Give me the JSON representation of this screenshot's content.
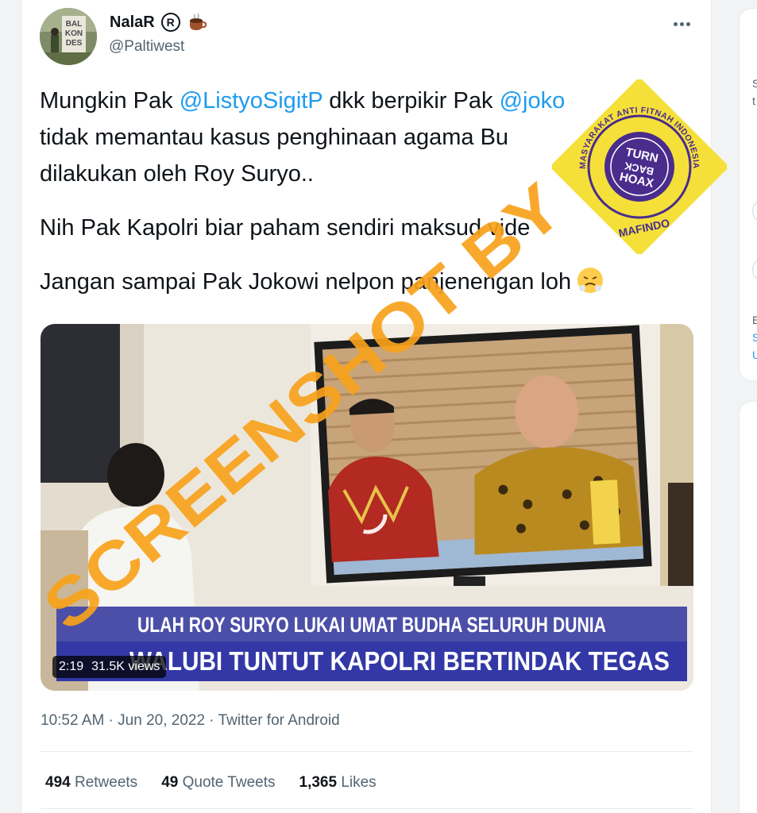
{
  "tweet": {
    "author_name": "NalaR",
    "author_handle": "@Paltiwest",
    "avatar_text": [
      "BAL",
      "KON",
      "DES"
    ],
    "text_lines": [
      [
        {
          "t": "Mungkin Pak "
        },
        {
          "t": "@ListyoSigitP",
          "m": true
        },
        {
          "t": " dkk berpikir Pak "
        },
        {
          "t": "@joko",
          "m": true
        }
      ],
      [
        {
          "t": "tidak memantau kasus penghinaan agama Bu"
        }
      ],
      [
        {
          "t": "dilakukan oleh Roy Suryo.."
        }
      ],
      [],
      [
        {
          "t": "Nih Pak Kapolri biar paham sendiri maksud vide"
        }
      ],
      [],
      [
        {
          "t": "Jangan sampai Pak Jokowi nelpon panjenengan loh "
        }
      ]
    ],
    "timestamp": "10:52 AM · Jun 20, 2022 · Twitter for Android",
    "stats": {
      "retweets_count": "494",
      "retweets_label": "Retweets",
      "quotes_count": "49",
      "quotes_label": "Quote Tweets",
      "likes_count": "1,365",
      "likes_label": "Likes"
    }
  },
  "video": {
    "duration": "2:19",
    "views": "31.5K views",
    "headline_top": "ULAH ROY SURYO LUKAI UMAT BUDHA SELURUH DUNIA",
    "headline_bottom": "WALUBI TUNTUT KAPOLRI BERTINDAK TEGAS",
    "colors": {
      "banner_top": "#4b4fa8",
      "banner_bottom": "#3338a6"
    }
  },
  "stamp": {
    "ring_text": "MASYARAKAT ANTI FITNAH INDONESIA",
    "inner_lines": [
      "TURN",
      "BACK",
      "HOAX"
    ],
    "bottom_text": "MAFINDO",
    "colors": {
      "yellow": "#f5e03a",
      "purple": "#4a2c8c"
    }
  },
  "watermark": {
    "text": "SCREENSHOT BY",
    "color": "#f7a21b"
  },
  "right_column": {
    "chars_top": [
      "S",
      "t"
    ],
    "chars_bottom": [
      "E",
      "S",
      "U"
    ]
  },
  "colors": {
    "accent": "#1d9bf0",
    "text": "#0f1419",
    "muted": "#536471"
  }
}
